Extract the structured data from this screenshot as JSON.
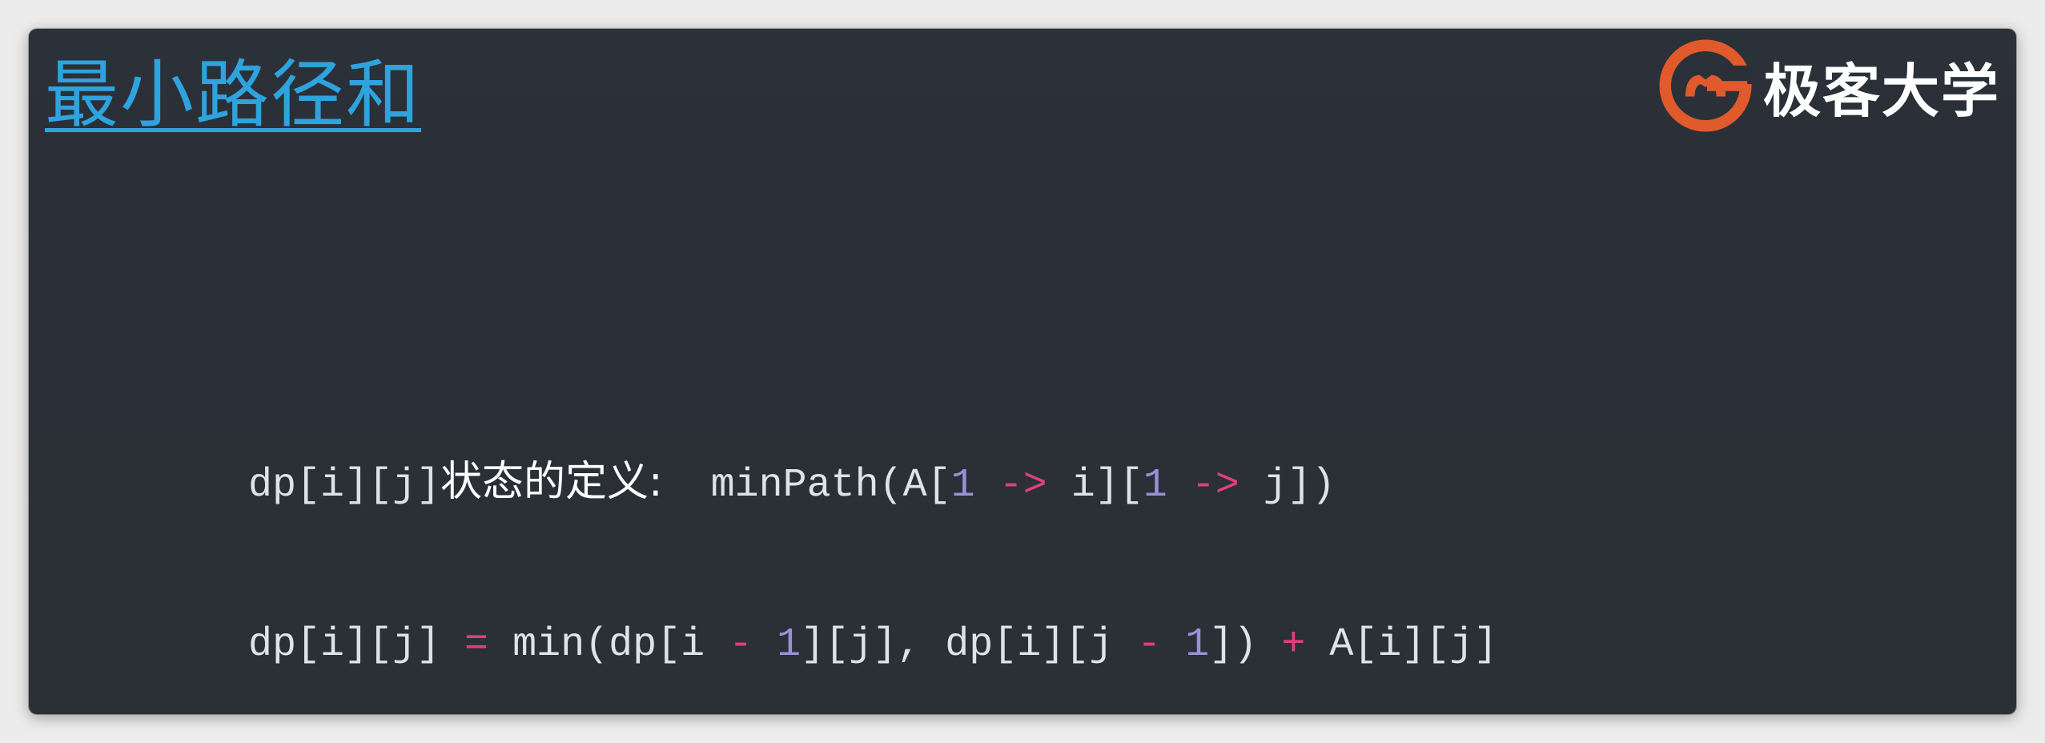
{
  "slide": {
    "title": "最小路径和",
    "brand": {
      "logo_icon": "geekbang-g-logo-icon",
      "name": "极客大学",
      "logo_color": "#e05a2b"
    },
    "line1": {
      "prefix": "dp[i][j]",
      "label": "状态的定义:",
      "gap": "  ",
      "t1": "minPath(A[",
      "n1": "1",
      "a1": " -> ",
      "t2": "i][",
      "n2": "1",
      "a2": " -> ",
      "t3": "j])"
    },
    "line2": {
      "t1": "dp[i][j] ",
      "eq": "=",
      "t2": " min(dp[i ",
      "m1": "-",
      "s1": " ",
      "n1": "1",
      "t3": "][j], dp[i][j ",
      "m2": "-",
      "s2": " ",
      "n2": "1",
      "t4": "]) ",
      "plus": "+",
      "t5": " A[i][j]"
    },
    "colors": {
      "background": "#2b3139",
      "title": "#2ea3dd",
      "code_text": "#dfe3e8",
      "number": "#9b8fd6",
      "operator": "#e0407a"
    }
  }
}
